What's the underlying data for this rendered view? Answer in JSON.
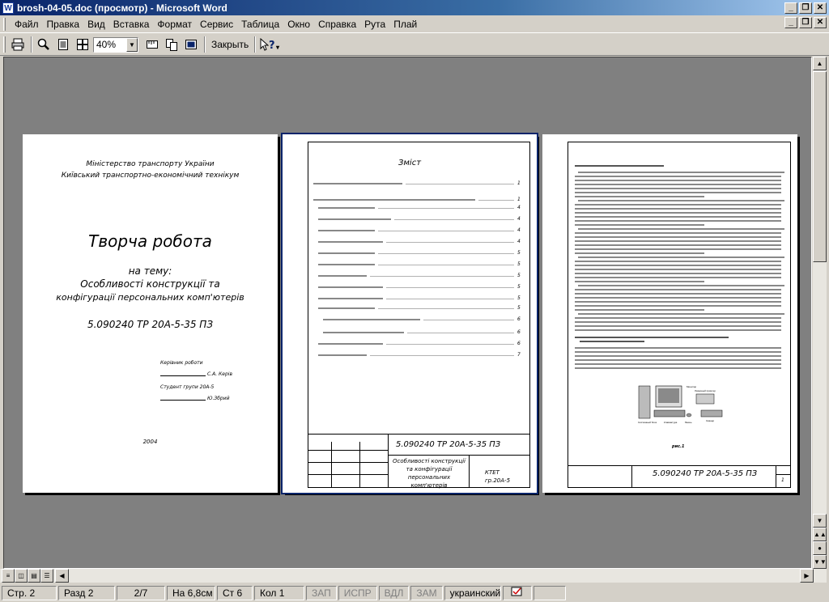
{
  "window": {
    "icon": "W",
    "title": "brosh-04-05.doc (просмотр) - Microsoft Word",
    "buttons": [
      "_",
      "❐",
      "✕"
    ]
  },
  "menu": [
    "Файл",
    "Правка",
    "Вид",
    "Вставка",
    "Формат",
    "Сервис",
    "Таблица",
    "Окно",
    "Справка",
    "Рута",
    "Плай"
  ],
  "toolbar": {
    "zoom": "40%",
    "close_label": "Закрыть"
  },
  "page1": {
    "ministry": "Міністерство транспорту України",
    "college": "Київський транспортно-економічний технікум",
    "heading": "Творча робота",
    "topic_intro": "на тему:",
    "topic_line1": "Особливості конструкції та",
    "topic_line2": "конфігурації персональних комп'ютерів",
    "code": "5.090240  ТР  20А-5-35  ПЗ",
    "supervisor_label": "Керівник роботи",
    "supervisor_name": "С.А. Керів",
    "student_label": "Студент групи 20А-5",
    "student_name": "Ю.Збрий",
    "year": "2004"
  },
  "page2": {
    "toc_title": "Зміст",
    "code": "5.090240  ТР  20А-5-35  ПЗ",
    "subject": "Особливості конструкції та конфігурації персональних комп'ютерів",
    "org": "КТЕТ",
    "group": "гр.20А-5",
    "toc_page_numbers": [
      "1",
      "1",
      "4",
      "4",
      "4",
      "4",
      "5",
      "5",
      "5",
      "5",
      "5",
      "5",
      "6",
      "6",
      "6",
      "7"
    ]
  },
  "page3": {
    "figure_caption": "рис.1",
    "code": "5.090240  ТР  20А-5-35  ПЗ",
    "page_no": "1",
    "figure_labels": [
      "Монитор",
      "Системный блок",
      "Клавиатура",
      "Мышь",
      "Лазерный принтер",
      "Сканер"
    ]
  },
  "status": {
    "page": "Стр. 2",
    "section": "Разд 2",
    "pages": "2/7",
    "at": "На 6,8см",
    "line": "Ст 6",
    "col": "Кол 1",
    "rec": "ЗАП",
    "trk": "ИСПР",
    "ext": "ВДЛ",
    "ovr": "ЗАМ",
    "language": "украинский"
  },
  "colors": {
    "title_gradient_start": "#0a246a",
    "workspace": "#808080",
    "chrome": "#d4d0c8"
  }
}
